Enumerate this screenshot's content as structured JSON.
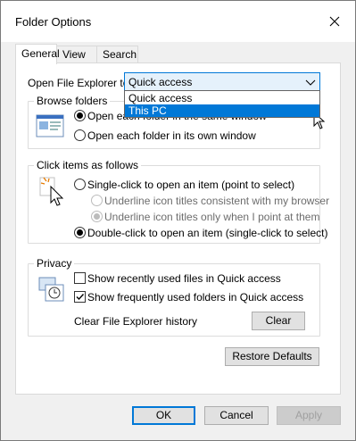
{
  "window": {
    "title": "Folder Options"
  },
  "tabs": [
    {
      "label": "General"
    },
    {
      "label": "View"
    },
    {
      "label": "Search"
    }
  ],
  "open_explorer": {
    "label": "Open File Explorer to:",
    "selected": "Quick access",
    "options": [
      "Quick access",
      "This PC"
    ],
    "highlighted": "This PC"
  },
  "browse_folders": {
    "title": "Browse folders",
    "options": [
      "Open each folder in the same window",
      "Open each folder in its own window"
    ],
    "selected_index": 0
  },
  "click_items": {
    "title": "Click items as follows",
    "single_click": "Single-click to open an item (point to select)",
    "underline_consistent": "Underline icon titles consistent with my browser",
    "underline_point": "Underline icon titles only when I point at them",
    "double_click": "Double-click to open an item (single-click to select)"
  },
  "privacy": {
    "title": "Privacy",
    "recent_files": "Show recently used files in Quick access",
    "frequent_folders": "Show frequently used folders in Quick access",
    "clear_history_label": "Clear File Explorer history",
    "clear_button": "Clear",
    "recent_files_checked": false,
    "frequent_folders_checked": true
  },
  "restore_defaults": "Restore Defaults",
  "footer": {
    "ok": "OK",
    "cancel": "Cancel",
    "apply": "Apply"
  }
}
